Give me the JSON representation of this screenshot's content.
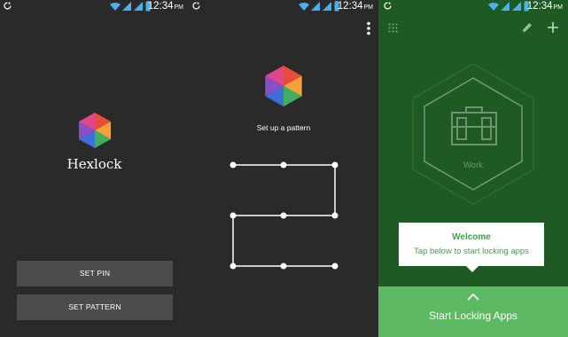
{
  "status_bar": {
    "time": "12:34",
    "ampm": "PM"
  },
  "screen1": {
    "app_name": "Hexlock",
    "buttons": [
      "SET PIN",
      "SET PATTERN"
    ]
  },
  "screen2": {
    "title": "Set up a pattern"
  },
  "screen3": {
    "profile_label": "Work",
    "welcome_title": "Welcome",
    "welcome_text": "Tap below to start locking apps",
    "start_button": "Start Locking Apps"
  },
  "colors": {
    "dark_bg": "#2a2a2b",
    "button_bg": "#4c4c4e",
    "green_bg": "#1f5a25",
    "green_accent": "#5db962",
    "welcome_text": "#3aa744"
  },
  "icons": [
    "sync-icon",
    "wifi-icon",
    "signal-icon",
    "signal-icon",
    "battery-icon",
    "more-vert-icon",
    "grid-icon",
    "pencil-icon",
    "plus-icon",
    "briefcase-icon",
    "chevron-up-icon"
  ]
}
